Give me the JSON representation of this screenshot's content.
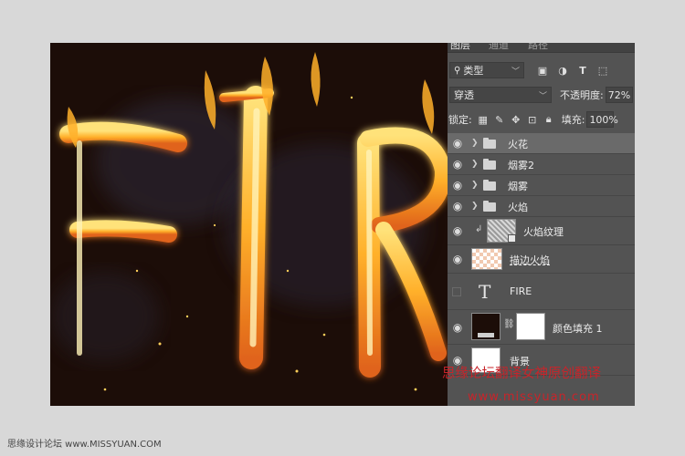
{
  "canvas": {
    "artwork_text": "FIRE"
  },
  "panel": {
    "tabs": [
      "图层",
      "通道",
      "路径"
    ],
    "filter": {
      "label": "类型"
    },
    "blend_mode": "穿透",
    "opacity_label": "不透明度:",
    "opacity_value": "72%",
    "lock_label": "锁定:",
    "fill_label": "填充:",
    "fill_value": "100%",
    "layers": [
      {
        "name": "火花",
        "kind": "group",
        "visible": true,
        "selected": true
      },
      {
        "name": "烟雾2",
        "kind": "group",
        "visible": true
      },
      {
        "name": "烟雾",
        "kind": "group",
        "visible": true
      },
      {
        "name": "火焰",
        "kind": "group",
        "visible": true
      },
      {
        "name": "火焰纹理",
        "kind": "smart-object",
        "visible": true,
        "clipped": true
      },
      {
        "name": "描边火焰",
        "kind": "pixel",
        "visible": true
      },
      {
        "name": "FIRE",
        "kind": "text",
        "visible": false,
        "glyph": "T"
      },
      {
        "name": "颜色填充 1",
        "kind": "fill",
        "visible": true
      },
      {
        "name": "背景",
        "kind": "background",
        "visible": true
      }
    ]
  },
  "watermark": {
    "line1": "思缘论坛翻译女神原创翻译",
    "line2": "www.missyuan.com",
    "color": "#c8242a"
  },
  "footer": {
    "site_credit": "思缘设计论坛 www.MISSYUAN.COM"
  },
  "colors": {
    "canvas_bg": "#1c0d08",
    "panel_bg": "#535353",
    "page_bg": "#d8d8d8"
  }
}
